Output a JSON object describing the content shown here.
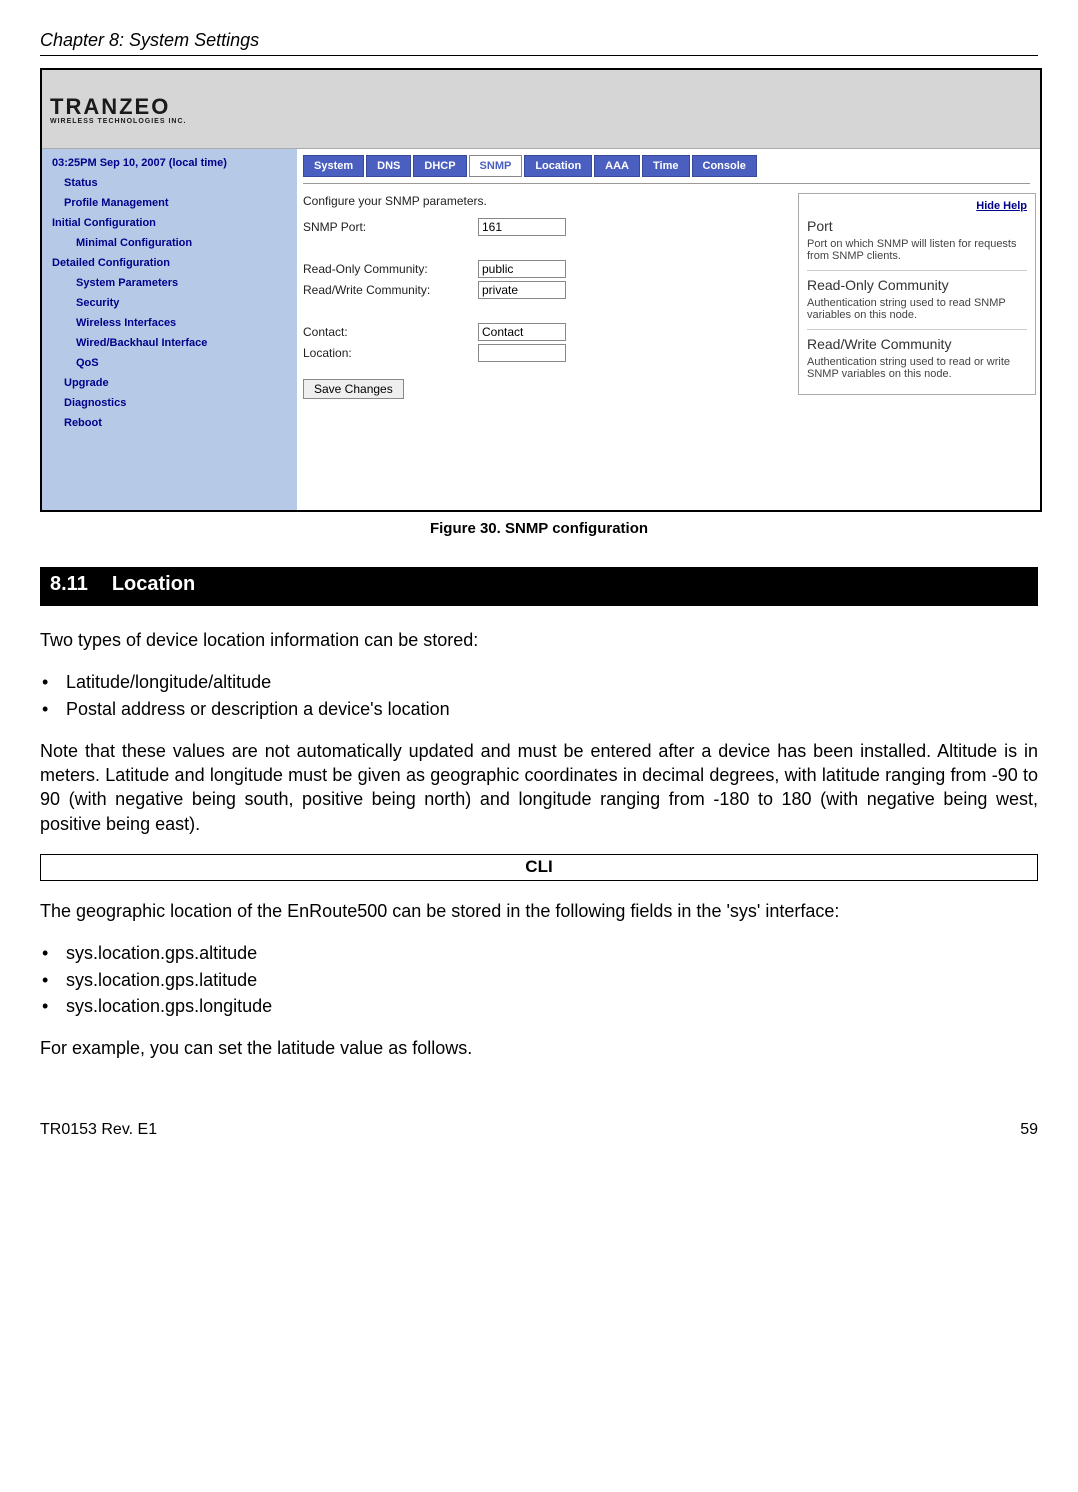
{
  "header": {
    "chapter": "Chapter 8: System Settings"
  },
  "screenshot": {
    "logo_main": "TRANZEO",
    "logo_sub": "WIRELESS TECHNOLOGIES INC.",
    "sidebar": {
      "datetime": "03:25PM Sep 10, 2007 (local time)",
      "items": [
        "Status",
        "Profile Management",
        "Initial Configuration",
        "Minimal Configuration",
        "Detailed Configuration",
        "System Parameters",
        "Security",
        "Wireless Interfaces",
        "Wired/Backhaul Interface",
        "QoS",
        "Upgrade",
        "Diagnostics",
        "Reboot"
      ]
    },
    "tabs": [
      "System",
      "DNS",
      "DHCP",
      "SNMP",
      "Location",
      "AAA",
      "Time",
      "Console"
    ],
    "active_tab": "SNMP",
    "form": {
      "intro": "Configure your SNMP parameters.",
      "snmp_port_label": "SNMP Port:",
      "snmp_port_value": "161",
      "ro_label": "Read-Only Community:",
      "ro_value": "public",
      "rw_label": "Read/Write Community:",
      "rw_value": "private",
      "contact_label": "Contact:",
      "contact_value": "Contact",
      "location_label": "Location:",
      "location_value": "",
      "save_btn": "Save Changes"
    },
    "help": {
      "hide": "Hide Help",
      "h1": "Port",
      "p1": "Port on which SNMP will listen for requests from SNMP clients.",
      "h2": "Read-Only Community",
      "p2": "Authentication string used to read SNMP variables on this node.",
      "h3": "Read/Write Community",
      "p3": "Authentication string used to read or write SNMP variables on this node."
    }
  },
  "figure_caption": "Figure 30. SNMP configuration",
  "section": {
    "num": "8.11",
    "title": "Location"
  },
  "paragraphs": {
    "p1": "Two types of device location information can be stored:",
    "bullets1": [
      "Latitude/longitude/altitude",
      "Postal address or description a device's location"
    ],
    "p2": "Note that these values are not automatically updated and must be entered after a device has been installed. Altitude is in meters. Latitude and longitude must be given as geographic coordinates in decimal degrees, with latitude ranging from -90 to 90 (with negative being south, positive being north) and longitude ranging from -180 to 180 (with negative being west, positive being east).",
    "cli": "CLI",
    "p3": "The geographic location of the EnRoute500 can be stored in the following fields in the 'sys' interface:",
    "bullets2": [
      "sys.location.gps.altitude",
      "sys.location.gps.latitude",
      "sys.location.gps.longitude"
    ],
    "p4": "For example, you can set the latitude value as follows."
  },
  "footer": {
    "left": "TR0153 Rev. E1",
    "right": "59"
  }
}
